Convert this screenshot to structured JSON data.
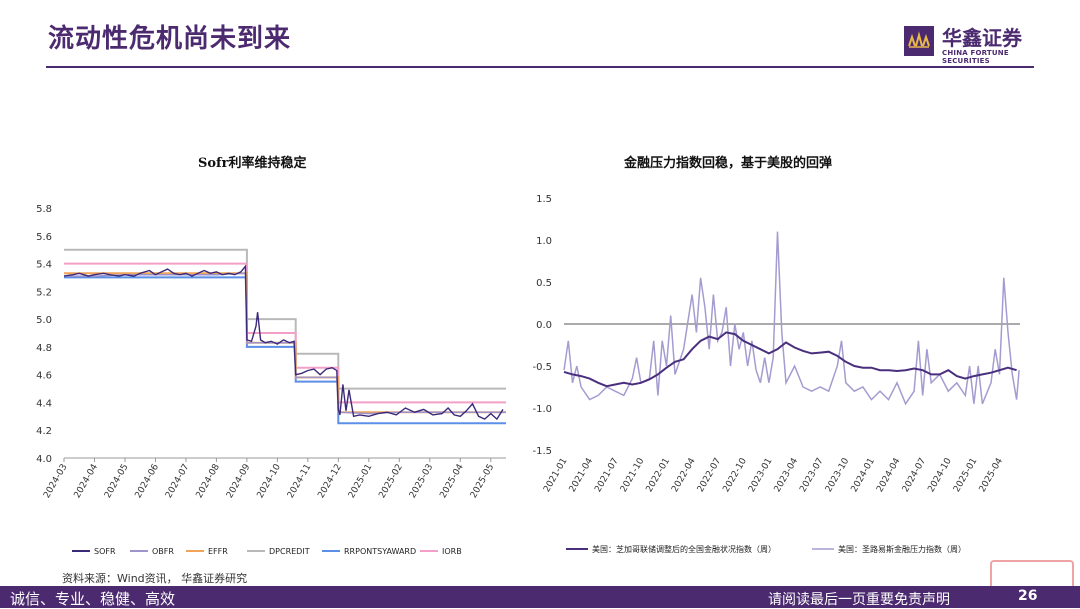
{
  "header": {
    "title": "流动性危机尚未到来",
    "logo_cn": "华鑫证券",
    "logo_en": "CHINA FORTUNE SECURITIES"
  },
  "footer": {
    "slogan": "诚信、专业、稳健、高效",
    "disclaimer": "请阅读最后一页重要免责声明",
    "page": "26"
  },
  "source": "资料来源：Wind资讯， 华鑫证券研究",
  "colors": {
    "brand": "#4b2a6f",
    "SOFR": "#3b2a7a",
    "OBFR": "#9d94cc",
    "EFFR": "#f0a35a",
    "DPCREDIT": "#b9b9b9",
    "RRPONTSYAWARD": "#5b8fe8",
    "IORB": "#f2a0c8",
    "chicago": "#4a2f7e",
    "stlouis": "#a59bd0"
  },
  "chart_data": [
    {
      "type": "line",
      "title": "Sofr利率维持稳定",
      "ylim": [
        4.0,
        5.8
      ],
      "yticks": [
        "5.8",
        "5.6",
        "5.4",
        "5.2",
        "5.0",
        "4.8",
        "4.6",
        "4.4",
        "4.2",
        "4.0"
      ],
      "xticks": [
        "2024-03",
        "2024-04",
        "2024-05",
        "2024-06",
        "2024-07",
        "2024-08",
        "2024-09",
        "2024-10",
        "2024-11",
        "2024-12",
        "2025-01",
        "2025-02",
        "2025-03",
        "2025-04",
        "2025-05"
      ],
      "x_domain": [
        "2024-03",
        "2025-05.5"
      ],
      "legend": [
        "SOFR",
        "OBFR",
        "EFFR",
        "DPCREDIT",
        "RRPONTSYAWARD",
        "IORB"
      ],
      "legend_position": "bottom",
      "steps": {
        "DPCREDIT": [
          [
            0,
            5.5
          ],
          [
            6,
            5.5
          ],
          [
            6,
            5.0
          ],
          [
            7.6,
            5.0
          ],
          [
            7.6,
            4.75
          ],
          [
            9,
            4.75
          ],
          [
            9,
            4.5
          ],
          [
            14.5,
            4.5
          ]
        ],
        "IORB": [
          [
            0,
            5.4
          ],
          [
            6,
            5.4
          ],
          [
            6,
            4.9
          ],
          [
            7.6,
            4.9
          ],
          [
            7.6,
            4.65
          ],
          [
            9,
            4.65
          ],
          [
            9,
            4.4
          ],
          [
            14.5,
            4.4
          ]
        ],
        "EFFR": [
          [
            0,
            5.33
          ],
          [
            6,
            5.33
          ],
          [
            6,
            4.83
          ],
          [
            7.6,
            4.83
          ],
          [
            7.6,
            4.58
          ],
          [
            9,
            4.58
          ],
          [
            9,
            4.33
          ],
          [
            14.5,
            4.33
          ]
        ],
        "RRPONTSYAWARD": [
          [
            0,
            5.3
          ],
          [
            6,
            5.3
          ],
          [
            6,
            4.8
          ],
          [
            7.6,
            4.8
          ],
          [
            7.6,
            4.55
          ],
          [
            9,
            4.55
          ],
          [
            9,
            4.25
          ],
          [
            14.5,
            4.25
          ]
        ]
      },
      "series_noisy": {
        "SOFR": [
          [
            0,
            5.31
          ],
          [
            0.3,
            5.32
          ],
          [
            0.5,
            5.33
          ],
          [
            0.8,
            5.31
          ],
          [
            1.0,
            5.32
          ],
          [
            1.3,
            5.33
          ],
          [
            1.5,
            5.32
          ],
          [
            1.8,
            5.31
          ],
          [
            2.0,
            5.32
          ],
          [
            2.3,
            5.31
          ],
          [
            2.5,
            5.33
          ],
          [
            2.8,
            5.35
          ],
          [
            3.0,
            5.32
          ],
          [
            3.2,
            5.34
          ],
          [
            3.4,
            5.36
          ],
          [
            3.6,
            5.33
          ],
          [
            3.8,
            5.32
          ],
          [
            4.0,
            5.33
          ],
          [
            4.2,
            5.31
          ],
          [
            4.4,
            5.33
          ],
          [
            4.6,
            5.35
          ],
          [
            4.8,
            5.33
          ],
          [
            5.0,
            5.34
          ],
          [
            5.2,
            5.32
          ],
          [
            5.4,
            5.33
          ],
          [
            5.6,
            5.32
          ],
          [
            5.8,
            5.34
          ],
          [
            5.95,
            5.38
          ],
          [
            6.0,
            4.85
          ],
          [
            6.15,
            4.84
          ],
          [
            6.3,
            4.95
          ],
          [
            6.35,
            5.05
          ],
          [
            6.45,
            4.85
          ],
          [
            6.6,
            4.83
          ],
          [
            6.8,
            4.84
          ],
          [
            7.0,
            4.82
          ],
          [
            7.2,
            4.85
          ],
          [
            7.4,
            4.83
          ],
          [
            7.55,
            4.84
          ],
          [
            7.6,
            4.6
          ],
          [
            7.8,
            4.61
          ],
          [
            8.0,
            4.63
          ],
          [
            8.2,
            4.64
          ],
          [
            8.4,
            4.6
          ],
          [
            8.6,
            4.64
          ],
          [
            8.8,
            4.65
          ],
          [
            8.95,
            4.63
          ],
          [
            9.0,
            4.35
          ],
          [
            9.05,
            4.31
          ],
          [
            9.15,
            4.53
          ],
          [
            9.25,
            4.34
          ],
          [
            9.35,
            4.49
          ],
          [
            9.5,
            4.3
          ],
          [
            9.7,
            4.31
          ],
          [
            10.0,
            4.3
          ],
          [
            10.3,
            4.32
          ],
          [
            10.6,
            4.33
          ],
          [
            10.9,
            4.31
          ],
          [
            11.2,
            4.36
          ],
          [
            11.5,
            4.33
          ],
          [
            11.8,
            4.35
          ],
          [
            12.1,
            4.31
          ],
          [
            12.4,
            4.32
          ],
          [
            12.6,
            4.36
          ],
          [
            12.8,
            4.31
          ],
          [
            13.0,
            4.3
          ],
          [
            13.2,
            4.34
          ],
          [
            13.4,
            4.39
          ],
          [
            13.6,
            4.3
          ],
          [
            13.8,
            4.28
          ],
          [
            14.0,
            4.32
          ],
          [
            14.2,
            4.28
          ],
          [
            14.4,
            4.35
          ]
        ],
        "OBFR": [
          [
            0,
            5.31
          ],
          [
            1,
            5.31
          ],
          [
            2,
            5.32
          ],
          [
            3,
            5.32
          ],
          [
            4,
            5.32
          ],
          [
            5,
            5.32
          ],
          [
            5.95,
            5.33
          ],
          [
            6.0,
            4.83
          ],
          [
            7.55,
            4.83
          ],
          [
            7.6,
            4.58
          ],
          [
            8.95,
            4.58
          ],
          [
            9.0,
            4.33
          ],
          [
            10,
            4.32
          ],
          [
            11,
            4.33
          ],
          [
            12,
            4.33
          ],
          [
            13,
            4.33
          ],
          [
            14.5,
            4.33
          ]
        ]
      }
    },
    {
      "type": "line",
      "title": "金融压力指数回稳，基于美股的回弹",
      "ylim": [
        -1.5,
        1.5
      ],
      "yticks": [
        "1.5",
        "1.0",
        "0.5",
        "0.0",
        "-0.5",
        "-1.0",
        "-1.5"
      ],
      "xticks": [
        "2021-01",
        "2021-04",
        "2021-07",
        "2021-10",
        "2022-01",
        "2022-04",
        "2022-07",
        "2022-10",
        "2023-01",
        "2023-04",
        "2023-07",
        "2023-10",
        "2024-01",
        "2024-04",
        "2024-07",
        "2024-10",
        "2025-01",
        "2025-04"
      ],
      "x_domain": [
        "2021-01",
        "2025-06"
      ],
      "legend_position": "bottom",
      "series": [
        {
          "name": "美国：芝加哥联储调整后的全国金融状况指数（周）",
          "points": [
            [
              0,
              -0.57
            ],
            [
              1,
              -0.6
            ],
            [
              2,
              -0.62
            ],
            [
              3,
              -0.65
            ],
            [
              4,
              -0.7
            ],
            [
              5,
              -0.74
            ],
            [
              6,
              -0.72
            ],
            [
              7,
              -0.7
            ],
            [
              8,
              -0.72
            ],
            [
              9,
              -0.7
            ],
            [
              10,
              -0.66
            ],
            [
              11,
              -0.6
            ],
            [
              12,
              -0.52
            ],
            [
              13,
              -0.45
            ],
            [
              14,
              -0.42
            ],
            [
              15,
              -0.3
            ],
            [
              16,
              -0.2
            ],
            [
              17,
              -0.15
            ],
            [
              18,
              -0.18
            ],
            [
              19,
              -0.1
            ],
            [
              20,
              -0.12
            ],
            [
              21,
              -0.2
            ],
            [
              22,
              -0.25
            ],
            [
              23,
              -0.3
            ],
            [
              24,
              -0.35
            ],
            [
              25,
              -0.3
            ],
            [
              26,
              -0.22
            ],
            [
              27,
              -0.28
            ],
            [
              28,
              -0.32
            ],
            [
              29,
              -0.35
            ],
            [
              30,
              -0.34
            ],
            [
              31,
              -0.33
            ],
            [
              32,
              -0.38
            ],
            [
              33,
              -0.45
            ],
            [
              34,
              -0.5
            ],
            [
              35,
              -0.52
            ],
            [
              36,
              -0.52
            ],
            [
              37,
              -0.55
            ],
            [
              38,
              -0.55
            ],
            [
              39,
              -0.56
            ],
            [
              40,
              -0.55
            ],
            [
              41,
              -0.53
            ],
            [
              42,
              -0.55
            ],
            [
              43,
              -0.6
            ],
            [
              44,
              -0.6
            ],
            [
              45,
              -0.55
            ],
            [
              46,
              -0.62
            ],
            [
              47,
              -0.65
            ],
            [
              48,
              -0.62
            ],
            [
              49,
              -0.6
            ],
            [
              50,
              -0.58
            ],
            [
              51,
              -0.55
            ],
            [
              52,
              -0.52
            ],
            [
              53,
              -0.55
            ]
          ]
        },
        {
          "name": "美国：圣路易斯金融压力指数（周）",
          "points": [
            [
              0,
              -0.55
            ],
            [
              0.5,
              -0.2
            ],
            [
              1,
              -0.7
            ],
            [
              1.5,
              -0.5
            ],
            [
              2,
              -0.75
            ],
            [
              3,
              -0.9
            ],
            [
              4,
              -0.85
            ],
            [
              5,
              -0.75
            ],
            [
              6,
              -0.8
            ],
            [
              7,
              -0.85
            ],
            [
              8,
              -0.65
            ],
            [
              8.5,
              -0.4
            ],
            [
              9,
              -0.7
            ],
            [
              10,
              -0.65
            ],
            [
              10.5,
              -0.2
            ],
            [
              11,
              -0.85
            ],
            [
              11.5,
              -0.2
            ],
            [
              12,
              -0.5
            ],
            [
              12.5,
              0.1
            ],
            [
              13,
              -0.6
            ],
            [
              14,
              -0.3
            ],
            [
              15,
              0.35
            ],
            [
              15.5,
              -0.1
            ],
            [
              16,
              0.55
            ],
            [
              16.5,
              0.2
            ],
            [
              17,
              -0.3
            ],
            [
              17.5,
              0.35
            ],
            [
              18,
              -0.2
            ],
            [
              18.5,
              -0.1
            ],
            [
              19,
              0.2
            ],
            [
              19.5,
              -0.5
            ],
            [
              20,
              0.0
            ],
            [
              20.5,
              -0.3
            ],
            [
              21,
              -0.1
            ],
            [
              21.5,
              -0.5
            ],
            [
              22,
              -0.2
            ],
            [
              22.5,
              -0.55
            ],
            [
              23,
              -0.7
            ],
            [
              23.5,
              -0.4
            ],
            [
              24,
              -0.7
            ],
            [
              24.5,
              -0.4
            ],
            [
              25,
              1.1
            ],
            [
              25.5,
              -0.1
            ],
            [
              26,
              -0.7
            ],
            [
              27,
              -0.5
            ],
            [
              28,
              -0.75
            ],
            [
              29,
              -0.8
            ],
            [
              30,
              -0.75
            ],
            [
              31,
              -0.8
            ],
            [
              32,
              -0.5
            ],
            [
              32.5,
              -0.2
            ],
            [
              33,
              -0.7
            ],
            [
              34,
              -0.8
            ],
            [
              35,
              -0.75
            ],
            [
              36,
              -0.9
            ],
            [
              37,
              -0.8
            ],
            [
              38,
              -0.9
            ],
            [
              39,
              -0.7
            ],
            [
              40,
              -0.95
            ],
            [
              41,
              -0.8
            ],
            [
              41.5,
              -0.2
            ],
            [
              42,
              -0.85
            ],
            [
              42.5,
              -0.3
            ],
            [
              43,
              -0.7
            ],
            [
              44,
              -0.6
            ],
            [
              45,
              -0.8
            ],
            [
              46,
              -0.7
            ],
            [
              47,
              -0.85
            ],
            [
              47.5,
              -0.5
            ],
            [
              48,
              -0.95
            ],
            [
              48.5,
              -0.5
            ],
            [
              49,
              -0.95
            ],
            [
              50,
              -0.7
            ],
            [
              50.5,
              -0.3
            ],
            [
              51,
              -0.6
            ],
            [
              51.5,
              0.55
            ],
            [
              52,
              -0.1
            ],
            [
              52.5,
              -0.6
            ],
            [
              53,
              -0.9
            ],
            [
              53.3,
              -0.55
            ]
          ]
        }
      ]
    }
  ]
}
